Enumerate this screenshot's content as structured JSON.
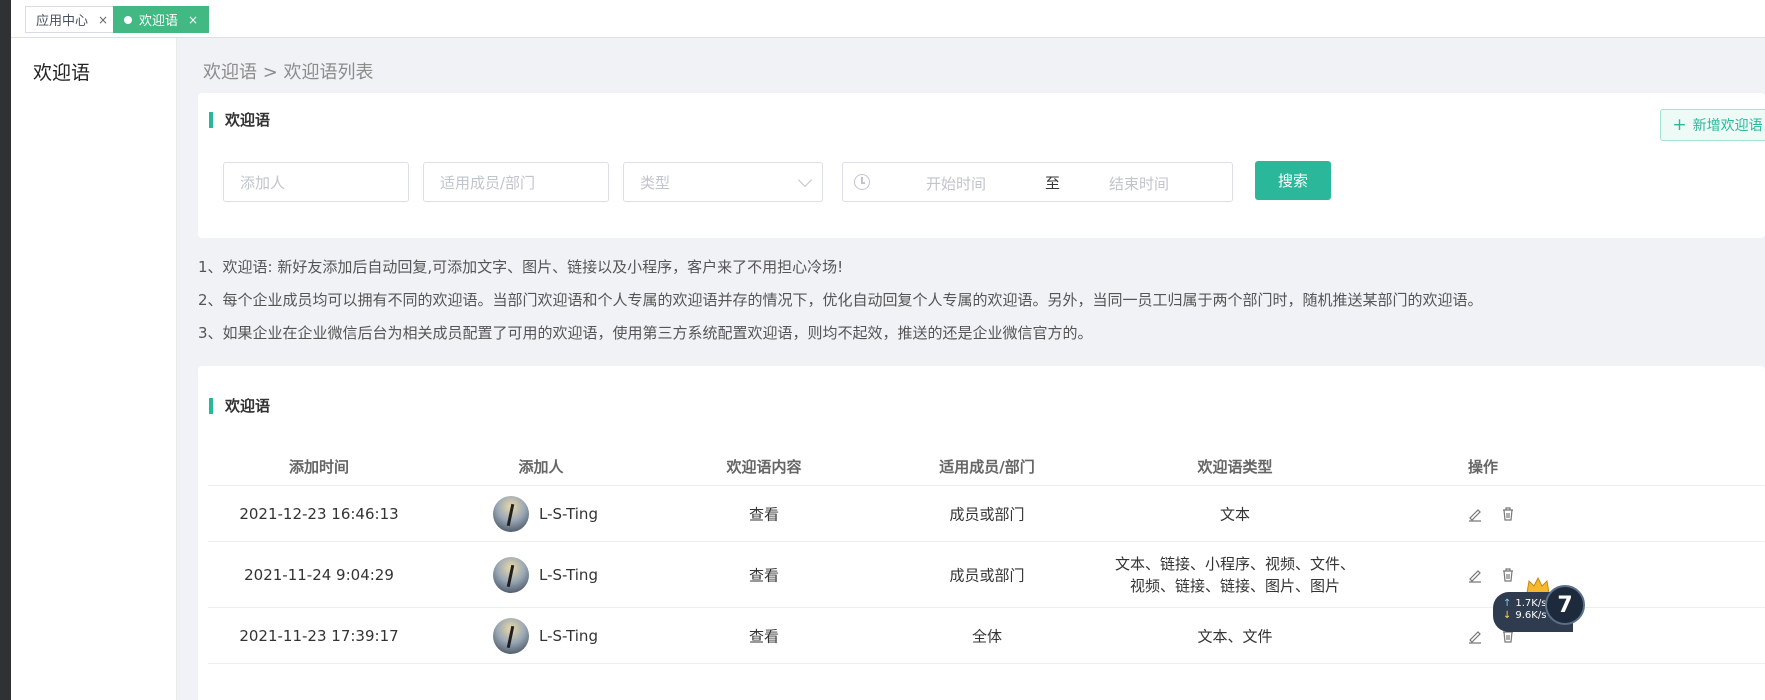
{
  "tabs": [
    {
      "label": "应用中心",
      "close": "×"
    },
    {
      "label": "欢迎语",
      "close": "×",
      "active": true
    }
  ],
  "side": {
    "title": "欢迎语"
  },
  "breadcrumb": "欢迎语 > 欢迎语列表",
  "filter": {
    "section_title": "欢迎语",
    "add_button": "新增欢迎语",
    "adder_placeholder": "添加人",
    "member_placeholder": "适用成员/部门",
    "type_placeholder": "类型",
    "start_placeholder": "开始时间",
    "separator": "至",
    "end_placeholder": "结束时间",
    "search_button": "搜索"
  },
  "notes": [
    "1、欢迎语: 新好友添加后自动回复,可添加文字、图片、链接以及小程序，客户来了不用担心冷场!",
    "2、每个企业成员均可以拥有不同的欢迎语。当部门欢迎语和个人专属的欢迎语并存的情况下，优化自动回复个人专属的欢迎语。另外，当同一员工归属于两个部门时，随机推送某部门的欢迎语。",
    "3、如果企业在企业微信后台为相关成员配置了可用的欢迎语，使用第三方系统配置欢迎语，则均不起效，推送的还是企业微信官方的。"
  ],
  "table": {
    "section_title": "欢迎语",
    "columns": [
      "添加时间",
      "添加人",
      "欢迎语内容",
      "适用成员/部门",
      "欢迎语类型",
      "操作"
    ],
    "rows": [
      {
        "time": "2021-12-23 16:46:13",
        "adder": "L-S-Ting",
        "content": "查看",
        "scope": "成员或部门",
        "type": "文本"
      },
      {
        "time": "2021-11-24 9:04:29",
        "adder": "L-S-Ting",
        "content": "查看",
        "scope": "成员或部门",
        "type": "文本、链接、小程序、视频、文件、视频、链接、链接、图片、图片"
      },
      {
        "time": "2021-11-23 17:39:17",
        "adder": "L-S-Ting",
        "content": "查看",
        "scope": "全体",
        "type": "文本、文件"
      }
    ]
  },
  "widget": {
    "up": "1.7K/s",
    "down": "9.6K/s",
    "ball": "7"
  },
  "icons": {
    "edit": "pencil-icon",
    "delete": "trash-icon",
    "clock": "clock-icon",
    "vip": "crown-icon"
  },
  "colors": {
    "accent": "#2bb89a",
    "tab_active": "#42b983"
  }
}
